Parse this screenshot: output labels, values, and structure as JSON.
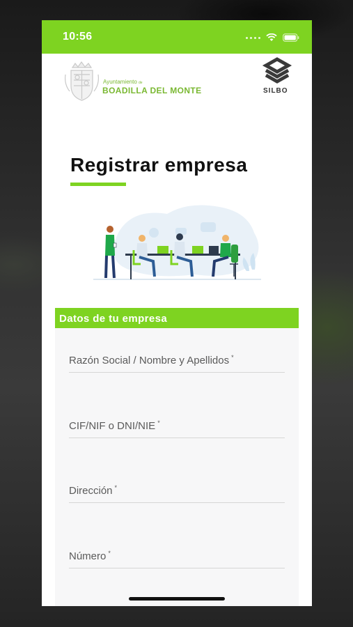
{
  "status_bar": {
    "time": "10:56"
  },
  "header": {
    "town_small": "Ayuntamiento",
    "town_small_de": "de",
    "town_name": "BOADILLA DEL MONTE",
    "app_brand": "SILBO"
  },
  "page": {
    "title": "Registrar empresa"
  },
  "form": {
    "section_title": "Datos de tu empresa",
    "required_mark": "*",
    "fields": [
      {
        "label": "Razón Social / Nombre y Apellidos",
        "value": ""
      },
      {
        "label": "CIF/NIF o DNI/NIE",
        "value": ""
      },
      {
        "label": "Dirección",
        "value": ""
      },
      {
        "label": "Número",
        "value": ""
      }
    ]
  },
  "colors": {
    "accent_green": "#7ed321",
    "town_green": "#7ab832"
  },
  "icons": [
    "signal-icon",
    "wifi-icon",
    "battery-icon",
    "town-crest-icon",
    "silbo-logo-icon",
    "office-illustration"
  ]
}
